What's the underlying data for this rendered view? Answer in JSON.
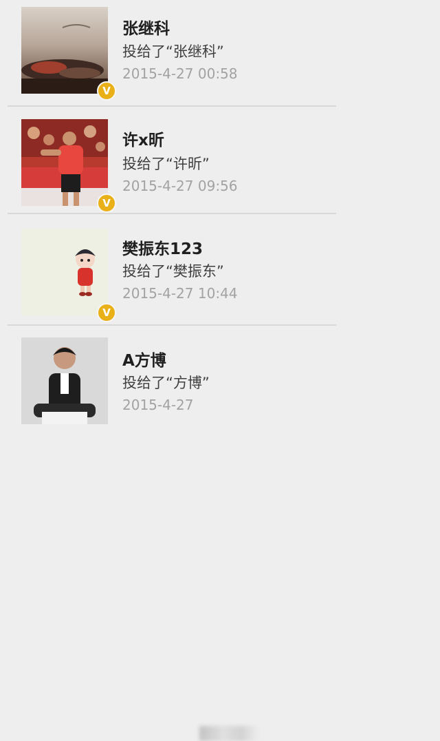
{
  "votes": [
    {
      "name": "张继科",
      "action": "投给了“张继科”",
      "time": "2015-4-27 00:58",
      "verified_badge": "V",
      "avatar": "artistic-photo"
    },
    {
      "name": "许x昕",
      "action": "投给了“许昕”",
      "time": "2015-4-27 09:56",
      "verified_badge": "V",
      "avatar": "table-tennis-player-photo"
    },
    {
      "name": "樊振东123",
      "action": "投给了“樊振东”",
      "time": "2015-4-27 10:44",
      "verified_badge": "V",
      "avatar": "cartoon-character"
    },
    {
      "name": "A方博",
      "action": "投给了“方博”",
      "time": "2015-4-27",
      "avatar": "portrait-photo"
    }
  ],
  "colors": {
    "background": "#eeeeee",
    "badge": "#e9b017",
    "name": "#1f1f1f",
    "action": "#3f3f3f",
    "time": "#a2a2a2"
  }
}
